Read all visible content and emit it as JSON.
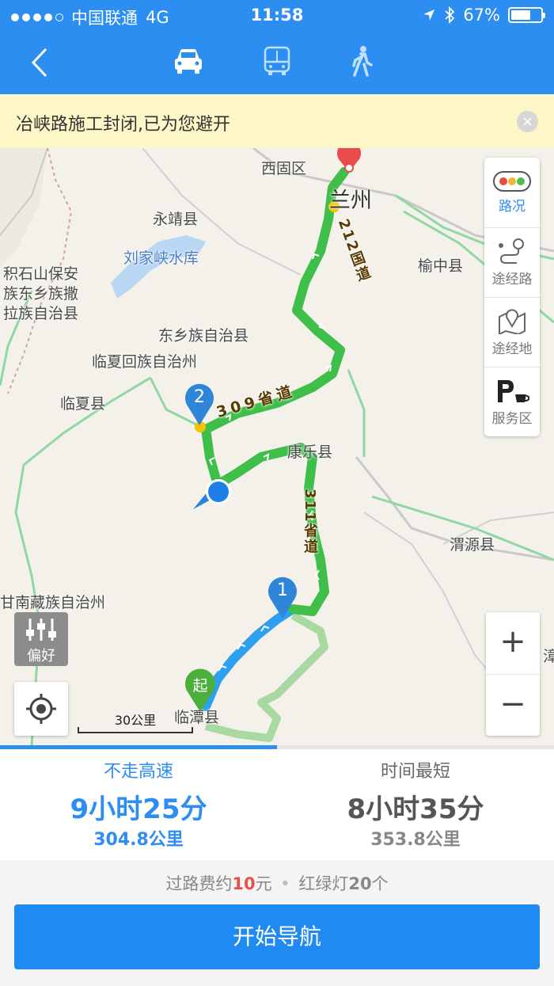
{
  "status": {
    "carrier": "中国联通",
    "network": "4G",
    "time": "11:58",
    "battery_text": "67%",
    "battery_level": 0.67
  },
  "nav": {
    "modes": [
      "car-icon",
      "bus-icon",
      "walk-icon"
    ],
    "active_mode": "car-icon"
  },
  "alert": {
    "message": "冶峡路施工封闭,已为您避开",
    "close": "×"
  },
  "map": {
    "places": {
      "xiguqu": "西固区",
      "lanzhou": "兰州",
      "yongjing": "永靖县",
      "liujiaxia": "刘家峡水库",
      "yuzhong": "榆中县",
      "jishishan": "积石山保安",
      "jishishan2": "族东乡族撒",
      "jishishan3": "拉族自治县",
      "dongxiang": "东乡族自治县",
      "linxia_zhou": "临夏回族自治州",
      "linxia": "临夏县",
      "kangle": "康乐县",
      "weiyuan": "渭源县",
      "gannan": "甘南藏族自治州",
      "lintan": "临潭县",
      "zhang": "漳"
    },
    "roads": {
      "r212": "212国道",
      "r309": "309省道",
      "r311": "311省道"
    },
    "markers": {
      "waypoint1": "1",
      "waypoint2": "2",
      "start": "起"
    },
    "side_panel": {
      "traffic": "路况",
      "via_road": "途经路",
      "via_place": "途经地",
      "service": "服务区"
    },
    "preference": "偏好",
    "zoom_in": "+",
    "zoom_out": "−",
    "scale": "30公里"
  },
  "routes": [
    {
      "name": "不走高速",
      "duration": "9小时25分",
      "distance": "304.8公里",
      "selected": true
    },
    {
      "name": "时间最短",
      "duration": "8小时35分",
      "distance": "353.8公里",
      "selected": false
    }
  ],
  "info": {
    "toll_prefix": "过路费约",
    "toll_value": "10",
    "toll_unit": "元",
    "separator": "•",
    "lights_prefix": "红绿灯",
    "lights_value": "20",
    "lights_unit": "个"
  },
  "start_button": "开始导航",
  "colors": {
    "accent": "#2b8ef0",
    "route_green": "#3fbf4a",
    "route_blue": "#2f9ff0",
    "alt_route": "#a9d8a0",
    "toll_highlight": "#e8514b"
  }
}
